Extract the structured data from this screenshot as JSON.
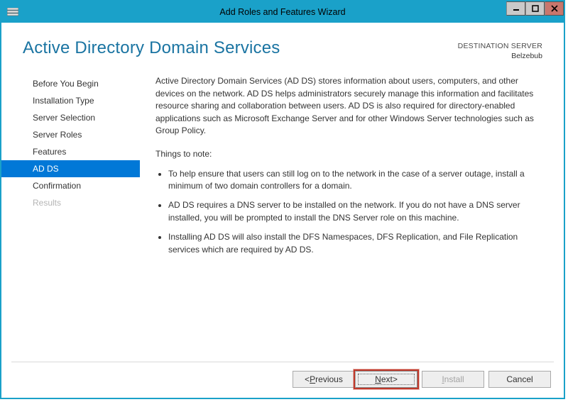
{
  "window": {
    "title": "Add Roles and Features Wizard"
  },
  "header": {
    "page_title": "Active Directory Domain Services",
    "dest_label": "DESTINATION SERVER",
    "dest_name": "Belzebub"
  },
  "sidebar": {
    "steps": [
      {
        "label": "Before You Begin",
        "state": "normal"
      },
      {
        "label": "Installation Type",
        "state": "normal"
      },
      {
        "label": "Server Selection",
        "state": "normal"
      },
      {
        "label": "Server Roles",
        "state": "normal"
      },
      {
        "label": "Features",
        "state": "normal"
      },
      {
        "label": "AD DS",
        "state": "active"
      },
      {
        "label": "Confirmation",
        "state": "normal"
      },
      {
        "label": "Results",
        "state": "disabled"
      }
    ]
  },
  "content": {
    "intro": "Active Directory Domain Services (AD DS) stores information about users, computers, and other devices on the network.  AD DS helps administrators securely manage this information and facilitates resource sharing and collaboration between users.  AD DS is also required for directory-enabled applications such as Microsoft Exchange Server and for other Windows Server technologies such as Group Policy.",
    "notes_title": "Things to note:",
    "bullets": [
      "To help ensure that users can still log on to the network in the case of a server outage, install a minimum of two domain controllers for a domain.",
      "AD DS requires a DNS server to be installed on the network.  If you do not have a DNS server installed, you will be prompted to install the DNS Server role on this machine.",
      "Installing AD DS will also install the DFS Namespaces, DFS Replication, and File Replication services which are required by AD DS."
    ]
  },
  "footer": {
    "previous_prefix": "< ",
    "previous_label": "Previous",
    "previous_mn": "P",
    "next_label": "Next",
    "next_suffix": " >",
    "next_mn": "N",
    "install_label": "Install",
    "install_mn": "I",
    "cancel_label": "Cancel"
  }
}
